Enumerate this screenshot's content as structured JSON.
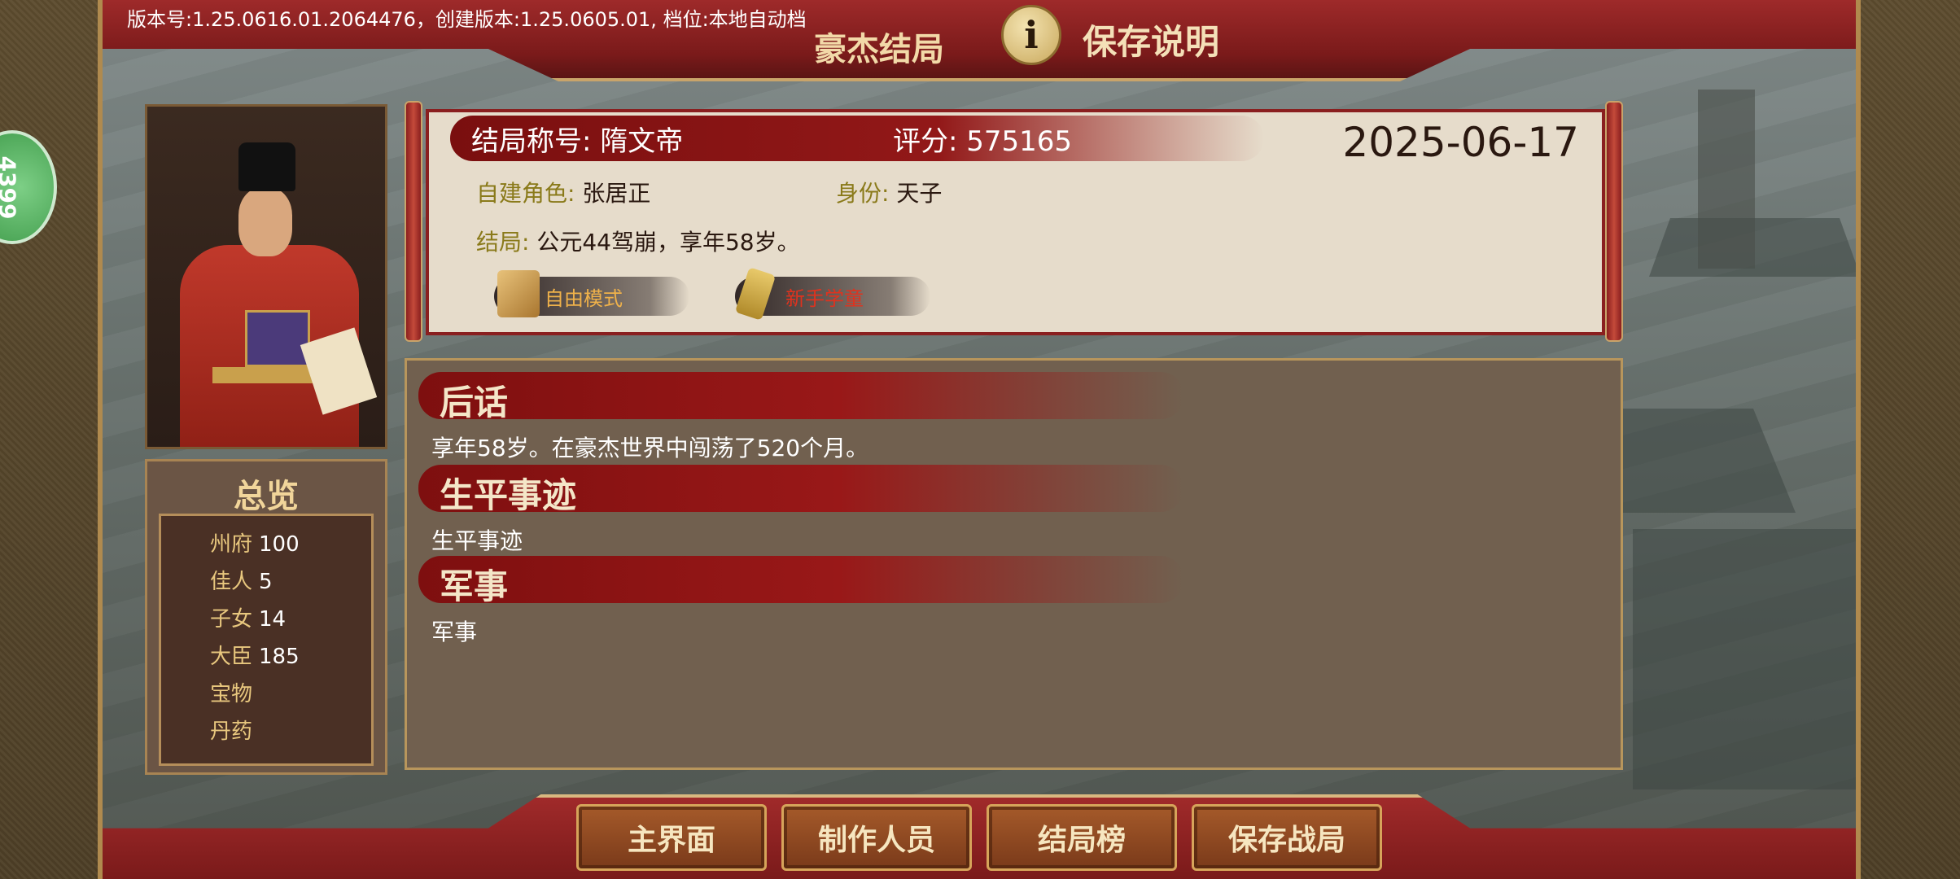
{
  "header": {
    "version_text": "版本号:1.25.0616.01.2064476，创建版本:1.25.0605.01, 档位:本地自动档",
    "title": "豪杰结局",
    "info_icon": "i",
    "save_description": "保存说明"
  },
  "side_bubble": {
    "text": "4399"
  },
  "overview": {
    "title": "总览",
    "items": [
      {
        "key": "州府",
        "value": "100"
      },
      {
        "key": "佳人",
        "value": "5"
      },
      {
        "key": "子女",
        "value": "14"
      },
      {
        "key": "大臣",
        "value": "185"
      },
      {
        "key": "宝物",
        "value": ""
      },
      {
        "key": "丹药",
        "value": ""
      }
    ]
  },
  "ending": {
    "title_label": "结局称号: 隋文帝",
    "score_label": "评分: 575165",
    "date": "2025-06-17",
    "role_key": "自建角色:",
    "role_value": " 张居正",
    "identity_key": "身份:",
    "identity_value": " 天子",
    "result_key": "结局:",
    "result_value": " 公元44驾崩，享年58岁。",
    "mode_free": "自由模式",
    "mode_novice": "新手学童"
  },
  "sections": [
    {
      "title": "后话",
      "body": "享年58岁。在豪杰世界中闯荡了520个月。"
    },
    {
      "title": "生平事迹",
      "body": "生平事迹"
    },
    {
      "title": "军事",
      "body": "军事"
    }
  ],
  "bottom_buttons": {
    "main_menu": "主界面",
    "credits": "制作人员",
    "ranking": "结局榜",
    "save_battle": "保存战局"
  },
  "colors": {
    "banner_red": "#8a1f1f",
    "gold_trim": "#c9a46a",
    "card_bg": "#e6dccb",
    "panel_bg": "#71604f"
  }
}
